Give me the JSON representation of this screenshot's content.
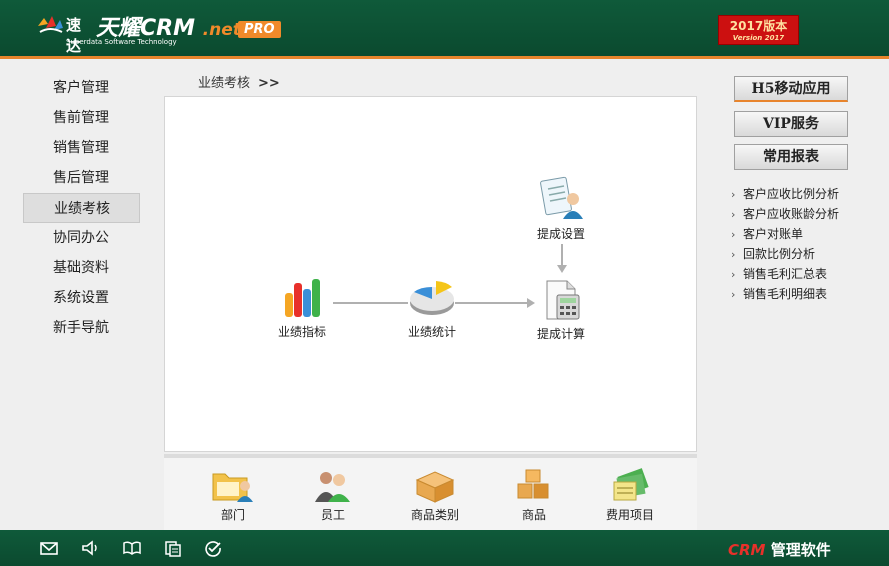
{
  "header": {
    "logo_cn": "速达",
    "logo_main": "天耀CRM",
    "logo_net": ".net",
    "logo_sub": "Superdata Software Technology",
    "pro_badge": "PRO",
    "version_line1": "2017版本",
    "version_line2": "Version 2017"
  },
  "nav": {
    "items": [
      {
        "label": "客户管理"
      },
      {
        "label": "售前管理"
      },
      {
        "label": "销售管理"
      },
      {
        "label": "售后管理"
      },
      {
        "label": "业绩考核"
      },
      {
        "label": "协同办公"
      },
      {
        "label": "基础资料"
      },
      {
        "label": "系统设置"
      },
      {
        "label": "新手导航"
      }
    ],
    "active": "业绩考核"
  },
  "breadcrumb": {
    "label": "业绩考核",
    "arrow": ">>"
  },
  "flow": {
    "metrics": "业绩指标",
    "stats": "业绩统计",
    "commission_setup": "提成设置",
    "commission_calc": "提成计算"
  },
  "quick": {
    "items": [
      {
        "label": "部门",
        "icon": "folder-person-icon"
      },
      {
        "label": "员工",
        "icon": "employees-icon"
      },
      {
        "label": "商品类别",
        "icon": "box-icon"
      },
      {
        "label": "商品",
        "icon": "boxes-icon"
      },
      {
        "label": "费用项目",
        "icon": "bills-icon"
      }
    ]
  },
  "right": {
    "buttons": [
      "H5移动应用",
      "VIP服务",
      "常用报表"
    ],
    "links": [
      "客户应收比例分析",
      "客户应收账龄分析",
      "客户对账单",
      "回款比例分析",
      "销售毛利汇总表",
      "销售毛利明细表"
    ]
  },
  "footer": {
    "icons": [
      "mail-icon",
      "speaker-icon",
      "book-icon",
      "copy-icon",
      "check-circle-icon"
    ],
    "brand_crm": "CRM",
    "brand_rest": "管理软件"
  },
  "colors": {
    "brand_green": "#0b4a2f",
    "accent_orange": "#e8842c",
    "version_red": "#cc1010"
  }
}
